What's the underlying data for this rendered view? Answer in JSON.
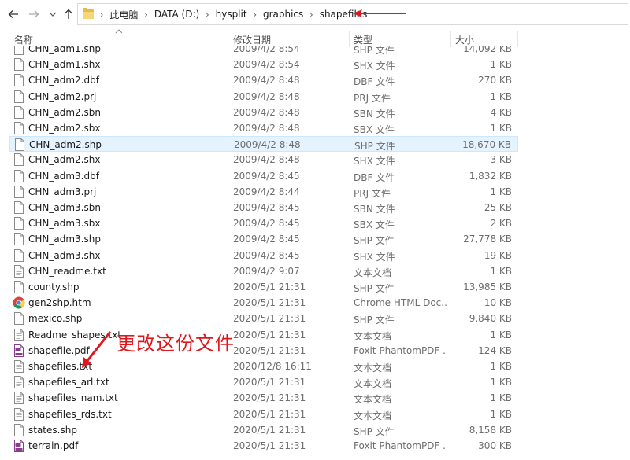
{
  "addressbar": {
    "crumbs": [
      "此电脑",
      "DATA (D:)",
      "hysplit",
      "graphics",
      "shapefiles"
    ]
  },
  "columns": {
    "name": "名称",
    "date": "修改日期",
    "type": "类型",
    "size": "大小"
  },
  "files": [
    {
      "name": "CHN_adm1.shp",
      "date": "2009/4/2 8:54",
      "type": "SHP 文件",
      "size": "14,092 KB",
      "icon": "file-icon"
    },
    {
      "name": "CHN_adm1.shx",
      "date": "2009/4/2 8:54",
      "type": "SHX 文件",
      "size": "1 KB",
      "icon": "file-icon"
    },
    {
      "name": "CHN_adm2.dbf",
      "date": "2009/4/2 8:48",
      "type": "DBF 文件",
      "size": "270 KB",
      "icon": "file-icon"
    },
    {
      "name": "CHN_adm2.prj",
      "date": "2009/4/2 8:48",
      "type": "PRJ 文件",
      "size": "1 KB",
      "icon": "file-icon"
    },
    {
      "name": "CHN_adm2.sbn",
      "date": "2009/4/2 8:48",
      "type": "SBN 文件",
      "size": "4 KB",
      "icon": "file-icon"
    },
    {
      "name": "CHN_adm2.sbx",
      "date": "2009/4/2 8:48",
      "type": "SBX 文件",
      "size": "1 KB",
      "icon": "file-icon"
    },
    {
      "name": "CHN_adm2.shp",
      "date": "2009/4/2 8:48",
      "type": "SHP 文件",
      "size": "18,670 KB",
      "icon": "file-icon",
      "selected": true
    },
    {
      "name": "CHN_adm2.shx",
      "date": "2009/4/2 8:48",
      "type": "SHX 文件",
      "size": "3 KB",
      "icon": "file-icon"
    },
    {
      "name": "CHN_adm3.dbf",
      "date": "2009/4/2 8:45",
      "type": "DBF 文件",
      "size": "1,832 KB",
      "icon": "file-icon"
    },
    {
      "name": "CHN_adm3.prj",
      "date": "2009/4/2 8:44",
      "type": "PRJ 文件",
      "size": "1 KB",
      "icon": "file-icon"
    },
    {
      "name": "CHN_adm3.sbn",
      "date": "2009/4/2 8:45",
      "type": "SBN 文件",
      "size": "25 KB",
      "icon": "file-icon"
    },
    {
      "name": "CHN_adm3.sbx",
      "date": "2009/4/2 8:45",
      "type": "SBX 文件",
      "size": "2 KB",
      "icon": "file-icon"
    },
    {
      "name": "CHN_adm3.shp",
      "date": "2009/4/2 8:45",
      "type": "SHP 文件",
      "size": "27,778 KB",
      "icon": "file-icon"
    },
    {
      "name": "CHN_adm3.shx",
      "date": "2009/4/2 8:45",
      "type": "SHX 文件",
      "size": "19 KB",
      "icon": "file-icon"
    },
    {
      "name": "CHN_readme.txt",
      "date": "2009/4/2 9:07",
      "type": "文本文档",
      "size": "1 KB",
      "icon": "text-file-icon"
    },
    {
      "name": "county.shp",
      "date": "2020/5/1 21:31",
      "type": "SHP 文件",
      "size": "13,985 KB",
      "icon": "file-icon"
    },
    {
      "name": "gen2shp.htm",
      "date": "2020/5/1 21:31",
      "type": "Chrome HTML Doc...",
      "size": "10 KB",
      "icon": "chrome-icon"
    },
    {
      "name": "mexico.shp",
      "date": "2020/5/1 21:31",
      "type": "SHP 文件",
      "size": "9,840 KB",
      "icon": "file-icon"
    },
    {
      "name": "Readme_shapes.txt",
      "date": "2020/5/1 21:31",
      "type": "文本文档",
      "size": "1 KB",
      "icon": "text-file-icon"
    },
    {
      "name": "shapefile.pdf",
      "date": "2020/5/1 21:31",
      "type": "Foxit PhantomPDF ...",
      "size": "124 KB",
      "icon": "pdf-icon"
    },
    {
      "name": "shapefiles.txt",
      "date": "2020/12/8 16:11",
      "type": "文本文档",
      "size": "1 KB",
      "icon": "text-file-icon"
    },
    {
      "name": "shapefiles_arl.txt",
      "date": "2020/5/1 21:31",
      "type": "文本文档",
      "size": "1 KB",
      "icon": "text-file-icon"
    },
    {
      "name": "shapefiles_nam.txt",
      "date": "2020/5/1 21:31",
      "type": "文本文档",
      "size": "1 KB",
      "icon": "text-file-icon"
    },
    {
      "name": "shapefiles_rds.txt",
      "date": "2020/5/1 21:31",
      "type": "文本文档",
      "size": "1 KB",
      "icon": "text-file-icon"
    },
    {
      "name": "states.shp",
      "date": "2020/5/1 21:31",
      "type": "SHP 文件",
      "size": "8,158 KB",
      "icon": "file-icon"
    },
    {
      "name": "terrain.pdf",
      "date": "2020/5/1 21:31",
      "type": "Foxit PhantomPDF ...",
      "size": "300 KB",
      "icon": "pdf-icon"
    }
  ],
  "annotation": {
    "text": "更改这份文件",
    "color": "#e0181e"
  },
  "colors": {
    "selected_bg": "#e5f3ff",
    "selected_border": "#cce8ff",
    "folder": "#f6d777"
  }
}
